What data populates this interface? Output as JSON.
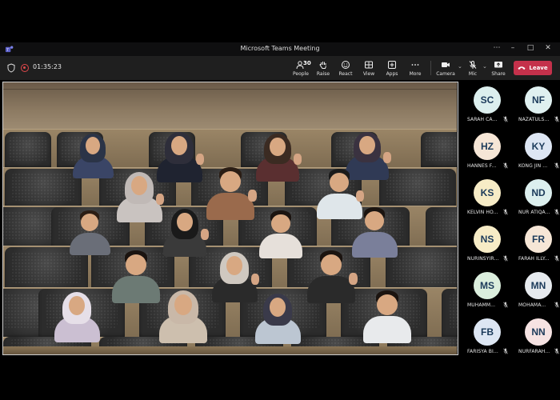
{
  "window": {
    "title": "Microsoft Teams Meeting"
  },
  "toolbar": {
    "timer": "01:35:23",
    "participant_count": "30",
    "buttons": [
      {
        "id": "people",
        "label": "People"
      },
      {
        "id": "raise",
        "label": "Raise"
      },
      {
        "id": "react",
        "label": "React"
      },
      {
        "id": "view",
        "label": "View"
      },
      {
        "id": "apps",
        "label": "Apps"
      },
      {
        "id": "more",
        "label": "More"
      },
      {
        "id": "camera",
        "label": "Camera"
      },
      {
        "id": "mic",
        "label": "Mic"
      },
      {
        "id": "share",
        "label": "Share"
      }
    ],
    "leave_label": "Leave"
  },
  "colors": {
    "leave": "#c4314b",
    "record": "#e0484b",
    "toolbar": "#1f1f1f",
    "avatar_text": "#1b3a5a"
  },
  "participants": [
    {
      "initials": "SC",
      "name": "SARAH CA...",
      "bg": "#dcefee"
    },
    {
      "initials": "NF",
      "name": "NAZATULS...",
      "bg": "#dff0f0"
    },
    {
      "initials": "HZ",
      "name": "HANNES F...",
      "bg": "#f6e6d6"
    },
    {
      "initials": "KY",
      "name": "KONG JIN ...",
      "bg": "#dde6f3"
    },
    {
      "initials": "KS",
      "name": "KELVIN HO...",
      "bg": "#f7ecc6"
    },
    {
      "initials": "ND",
      "name": "NUR ATIQA...",
      "bg": "#dcefee"
    },
    {
      "initials": "NS",
      "name": "NURINSYIR...",
      "bg": "#f7ecc6"
    },
    {
      "initials": "FR",
      "name": "FARAH ILLY...",
      "bg": "#f6e6d6"
    },
    {
      "initials": "MS",
      "name": "MUHAMM...",
      "bg": "#dbeedd"
    },
    {
      "initials": "MN",
      "name": "MOHAMA...",
      "bg": "#e6eaee"
    },
    {
      "initials": "FB",
      "name": "FARISYA BI...",
      "bg": "#dde6f3"
    },
    {
      "initials": "NN",
      "name": "NURFARAH...",
      "bg": "#f6e3e3"
    }
  ]
}
